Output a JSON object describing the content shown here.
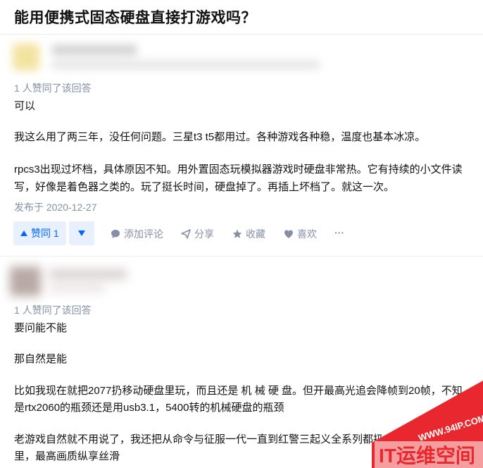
{
  "question": {
    "title": "能用便携式固态硬盘直接打游戏吗？"
  },
  "answer1": {
    "agree_count": "1 人赞同了该回答",
    "paragraphs": [
      "可以",
      "我这么用了两三年，没任何问题。三星t3 t5都用过。各种游戏各种稳，温度也基本冰凉。",
      "rpcs3出现过坏档，具体原因不知。用外置固态玩模拟器游戏时硬盘非常热。它有持续的小文件读",
      "写，好像是着色器之类的。玩了挺长时间，硬盘掉了。再插上坏档了。就这一次。"
    ],
    "published": "发布于 2020-12-27"
  },
  "actions": {
    "upvote": "赞同 1",
    "comment": "添加评论",
    "share": "分享",
    "favorite": "收藏",
    "like": "喜欢",
    "more": "···"
  },
  "answer2": {
    "agree_count": "1 人赞同了该回答",
    "paragraphs": [
      "要问能不能",
      "那自然是能",
      "比如我现在就把2077扔移动硬盘里玩，而且还是 机 械 硬 盘。但开最高光追会降帧到20帧，不知",
      "是rtx2060的瓶颈还是用usb3.1，5400转的机械硬盘的瓶颈",
      "老游戏自然就不用说了，我还把从命令与征服一代一直到红警三起义全系列都扔",
      "里，最高画质纵享丝滑"
    ]
  },
  "watermark": {
    "url": "WWW.94IP.COM",
    "brand": "IT运维空间"
  },
  "colors": {
    "accent": "#0066ff",
    "muted": "#8590a6",
    "watermark_red": "#e8282e"
  }
}
